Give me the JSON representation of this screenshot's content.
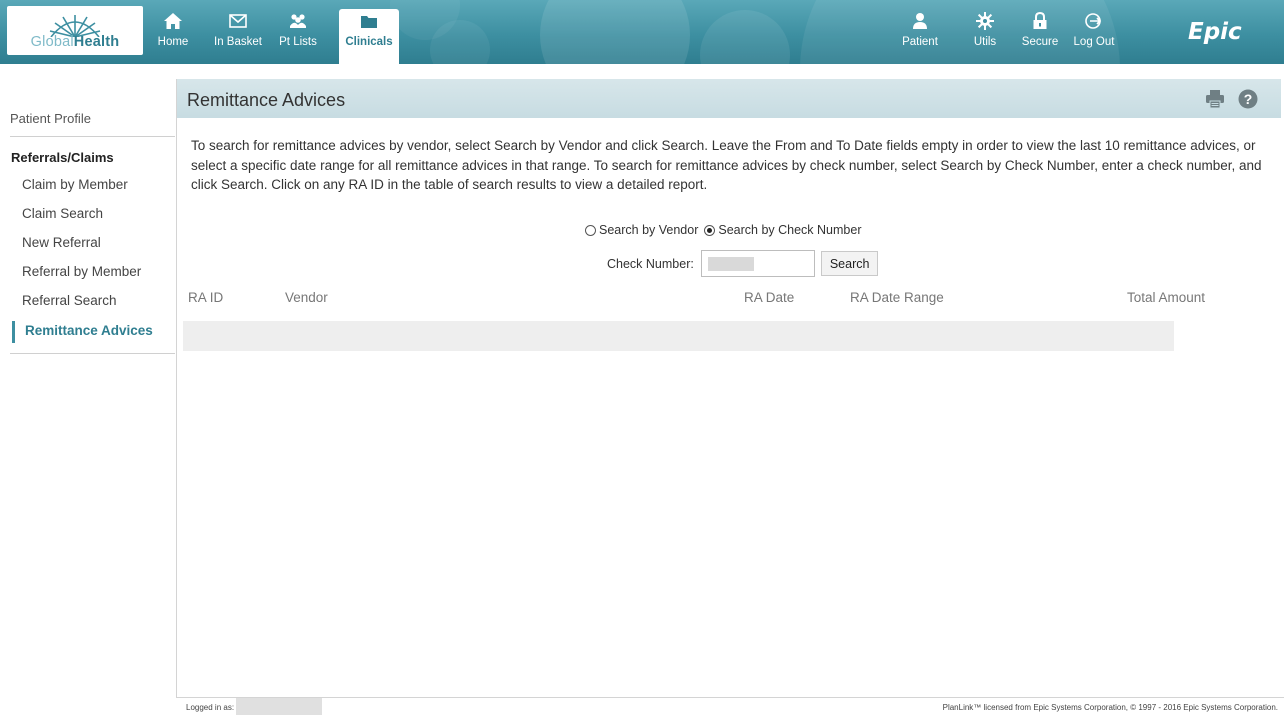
{
  "app": {
    "logo": {
      "part1": "Global",
      "part2": "Health"
    },
    "brand": "Epic"
  },
  "nav": {
    "left": [
      {
        "label": "Home",
        "icon": "home-icon"
      },
      {
        "label": "In Basket",
        "icon": "envelope-icon"
      },
      {
        "label": "Pt Lists",
        "icon": "people-icon"
      },
      {
        "label": "Clinicals",
        "icon": "folder-icon",
        "active": true
      }
    ],
    "right": [
      {
        "label": "Patient",
        "icon": "person-icon"
      },
      {
        "label": "Utils",
        "icon": "gear-icon"
      },
      {
        "label": "Secure",
        "icon": "lock-icon"
      },
      {
        "label": "Log Out",
        "icon": "logout-icon"
      }
    ]
  },
  "sidebar": {
    "profile": "Patient Profile",
    "section": "Referrals/Claims",
    "items": [
      {
        "label": "Claim by Member"
      },
      {
        "label": "Claim Search"
      },
      {
        "label": "New Referral"
      },
      {
        "label": "Referral by Member"
      },
      {
        "label": "Referral Search"
      },
      {
        "label": "Remittance Advices",
        "active": true
      }
    ]
  },
  "main": {
    "title": "Remittance Advices",
    "instructions": "To search for remittance advices by vendor, select Search by Vendor and click Search. Leave the From and To Date fields empty in order to view the last 10 remittance advices, or select a specific date range for all remittance advices in that range. To search for remittance advices by check number, select Search by Check Number, enter a check number, and click Search. Click on any RA ID in the table of search results to view a detailed report.",
    "search_mode": {
      "options": [
        "Search by Vendor",
        "Search by Check Number"
      ],
      "selected": "Search by Check Number"
    },
    "check_number": {
      "label": "Check Number:",
      "value": ""
    },
    "search_button": "Search",
    "table": {
      "columns": [
        "RA ID",
        "Vendor",
        "RA Date",
        "RA Date Range",
        "Total Amount"
      ],
      "rows": []
    }
  },
  "footer": {
    "logged_in_label": "Logged in as:",
    "copyright": "PlanLink™ licensed from Epic Systems Corporation, © 1997 - 2016 Epic Systems Corporation."
  },
  "colors": {
    "accent": "#3d8fa1",
    "header_bg": "#c7dce2"
  }
}
